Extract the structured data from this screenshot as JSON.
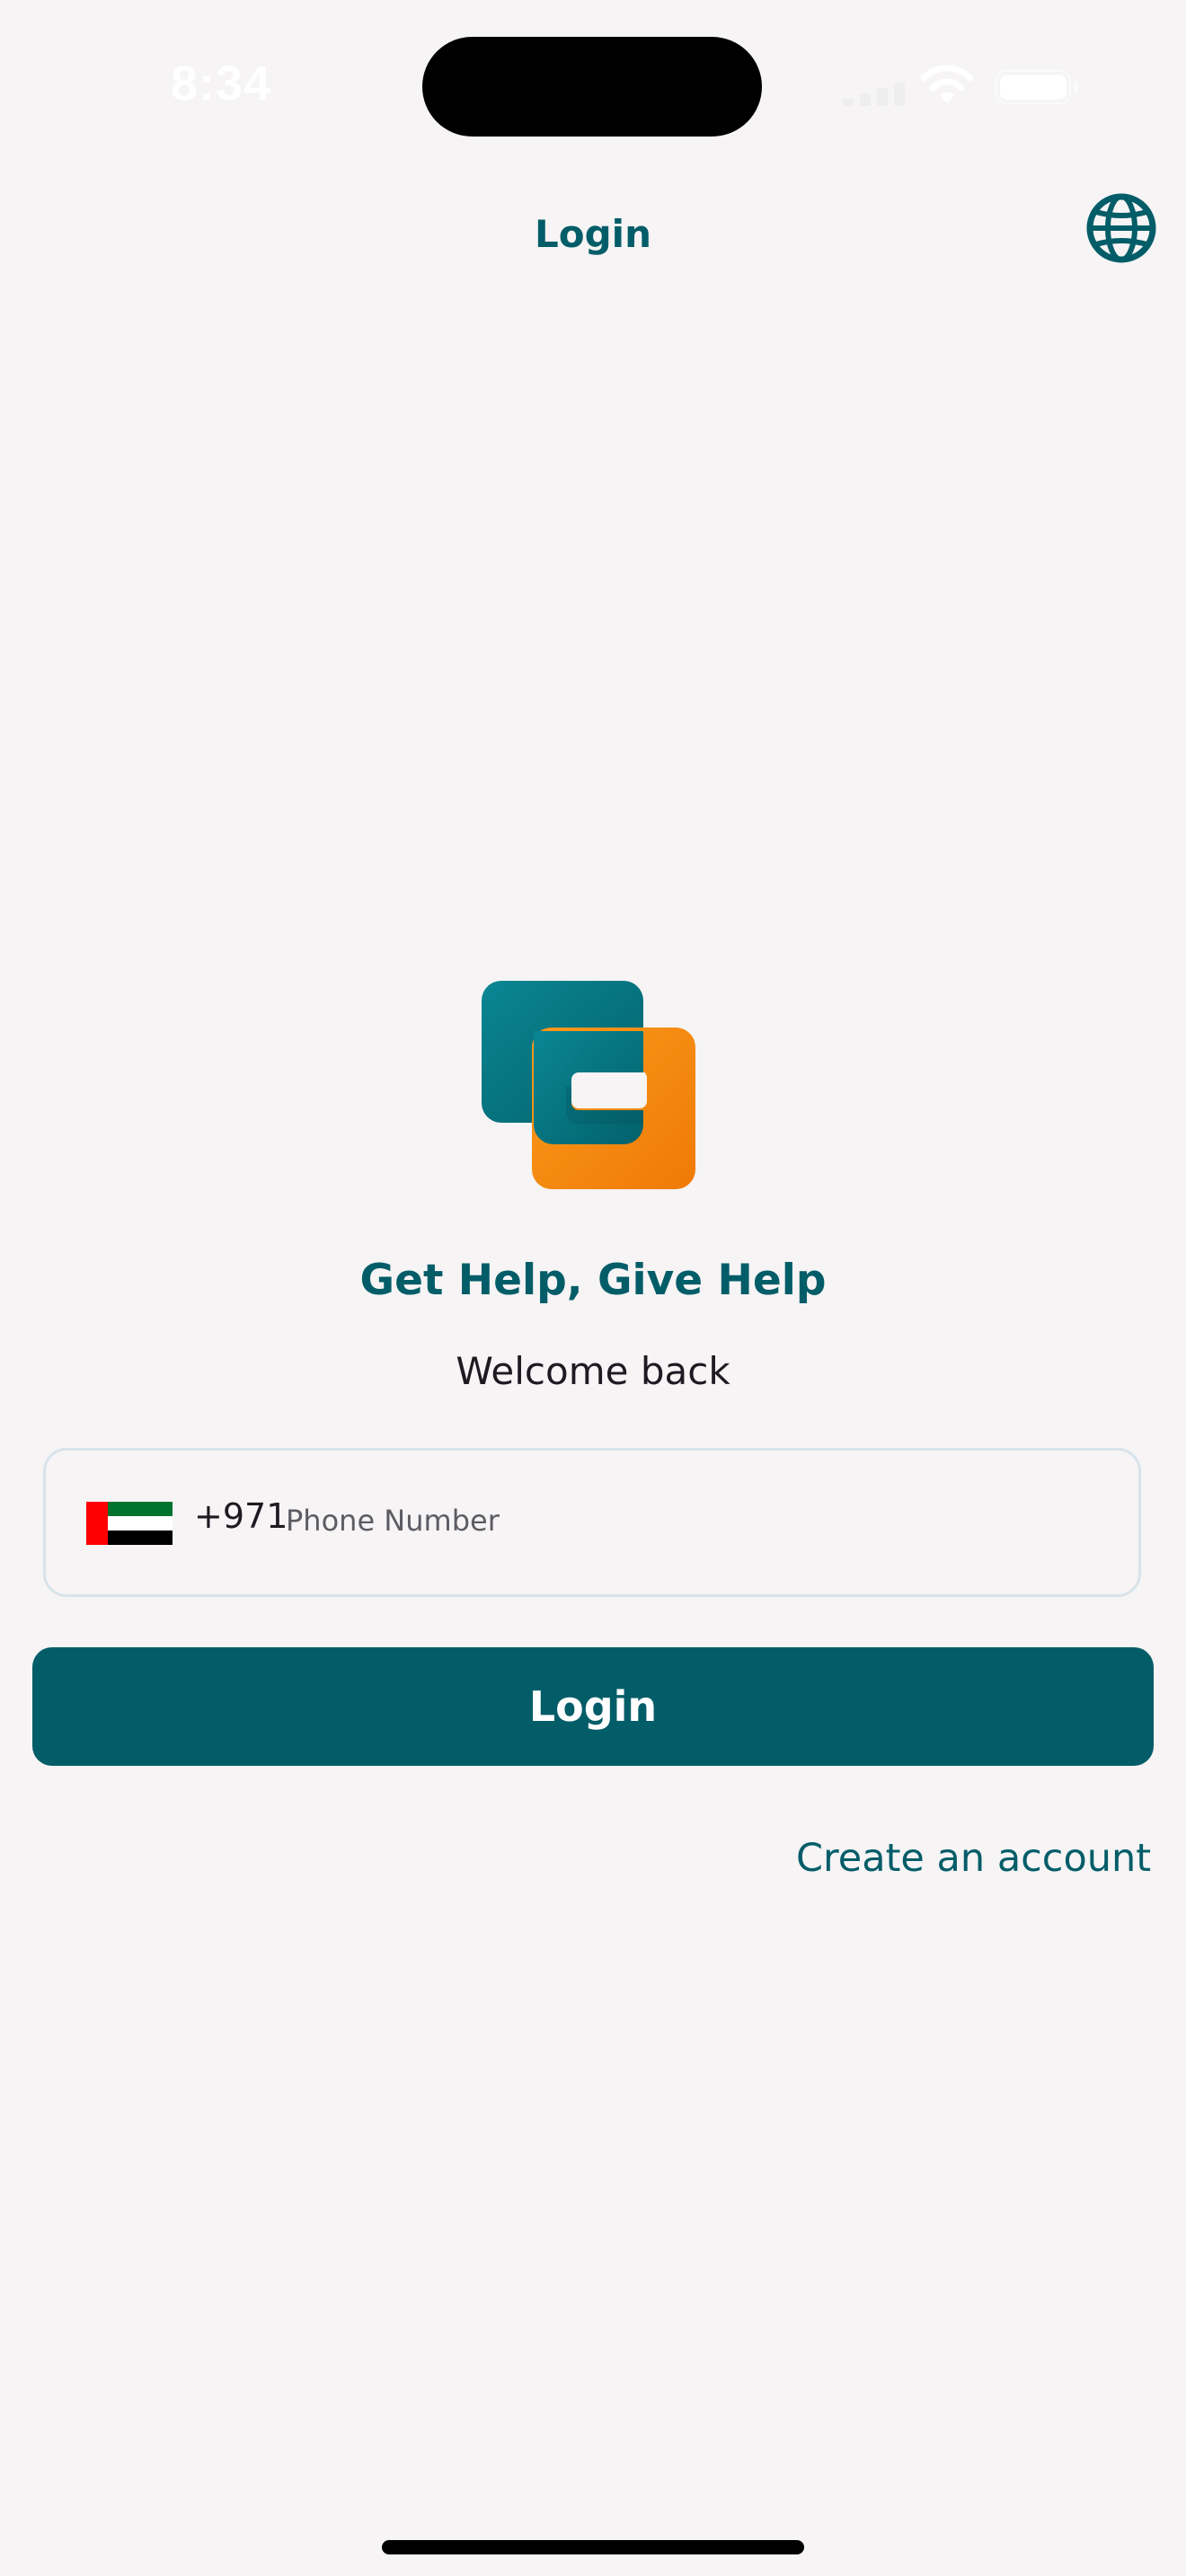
{
  "status_bar": {
    "time": "8:34",
    "icons": [
      "cellular-signal-icon",
      "wifi-icon",
      "battery-icon"
    ]
  },
  "header": {
    "title": "Login",
    "language_icon": "globe-icon"
  },
  "brand": {
    "logo": "app-logo",
    "tagline": "Get Help, Give Help",
    "welcome": "Welcome back"
  },
  "phone": {
    "country_flag": "uae-flag-icon",
    "dial_code": "+971",
    "placeholder": "Phone Number",
    "value": ""
  },
  "actions": {
    "login_label": "Login",
    "create_account_label": "Create an account"
  },
  "colors": {
    "primary": "#035d68",
    "accent_orange": "#f5890f",
    "background": "#f6f4f5",
    "text": "#1d1a22"
  }
}
